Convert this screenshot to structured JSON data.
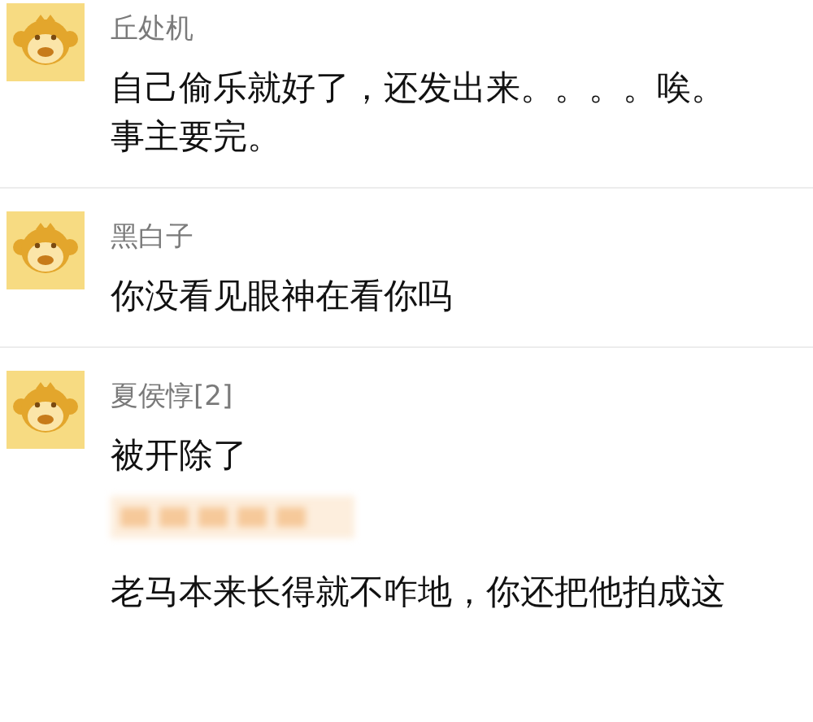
{
  "comments": [
    {
      "name": "丘处机",
      "avatar": {
        "kind": "monkey"
      },
      "blocks": [
        {
          "kind": "text",
          "text": "自己偷乐就好了，还发出来。。。。唉。事主要完。"
        }
      ]
    },
    {
      "name": "黑白子",
      "avatar": {
        "kind": "monkey"
      },
      "blocks": [
        {
          "kind": "text",
          "text": "你没看见眼神在看你吗"
        }
      ]
    },
    {
      "name": "夏侯惇[2]",
      "avatar": {
        "kind": "monkey"
      },
      "blocks": [
        {
          "kind": "text",
          "text": "被开除了"
        },
        {
          "kind": "blurred"
        },
        {
          "kind": "text",
          "text": "老马本来长得就不咋地，你还把他拍成这"
        }
      ]
    }
  ]
}
